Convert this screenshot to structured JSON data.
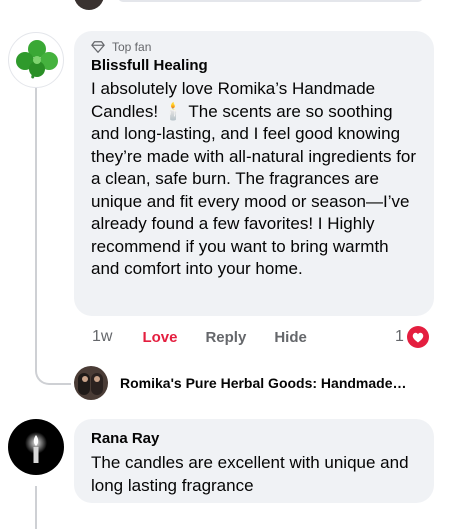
{
  "comments": [
    {
      "badge": "Top fan",
      "author": "Blissfull Healing",
      "text": "I absolutely love Romika’s Handmade Candles! 🕯️ The scents are so soothing and long-lasting, and I feel good knowing they’re made with all-natural ingredients for a clean, safe burn. The fragrances are unique and fit every mood or season—I’ve already found a few favorites! I Highly recommend if you want to bring warmth and comfort into your home.",
      "time": "1w",
      "love_label": "Love",
      "reply_label": "Reply",
      "hide_label": "Hide",
      "reaction_count": "1",
      "reply_preview": "Romika's Pure Herbal Goods: Handmade…"
    },
    {
      "author": "Rana Ray",
      "text": "The candles are excellent with unique and long lasting fragrance"
    }
  ],
  "colors": {
    "love": "#e41e3f",
    "bubble": "#f0f2f5",
    "secondary_text": "#65676b",
    "thread_line": "#ced0d4"
  },
  "icons": {
    "badge": "diamond-icon",
    "reaction": "heart-icon",
    "avatar1": "clover-icon",
    "avatar3": "candle-icon"
  }
}
